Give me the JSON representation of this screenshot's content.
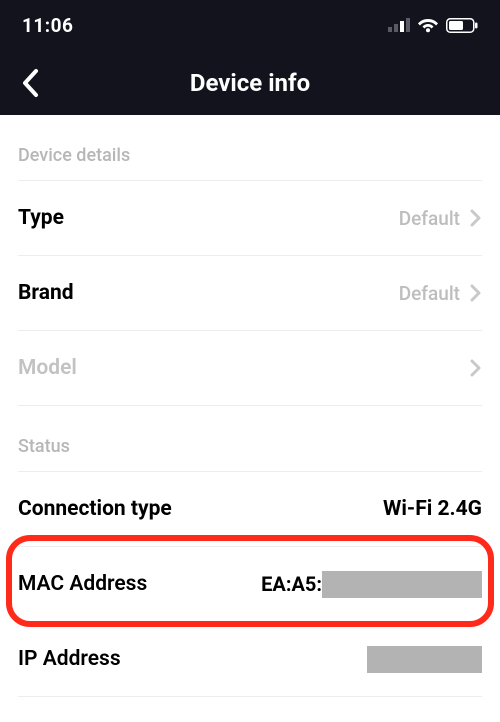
{
  "status": {
    "time": "11:06"
  },
  "nav": {
    "title": "Device info"
  },
  "sections": {
    "details": {
      "header": "Device details",
      "type_label": "Type",
      "type_value": "Default",
      "brand_label": "Brand",
      "brand_value": "Default",
      "model_label": "Model",
      "model_value": ""
    },
    "status": {
      "header": "Status",
      "conn_label": "Connection type",
      "conn_value": "Wi-Fi 2.4G",
      "mac_label": "MAC Address",
      "mac_prefix": "EA:A5:",
      "ip_label": "IP Address"
    }
  }
}
